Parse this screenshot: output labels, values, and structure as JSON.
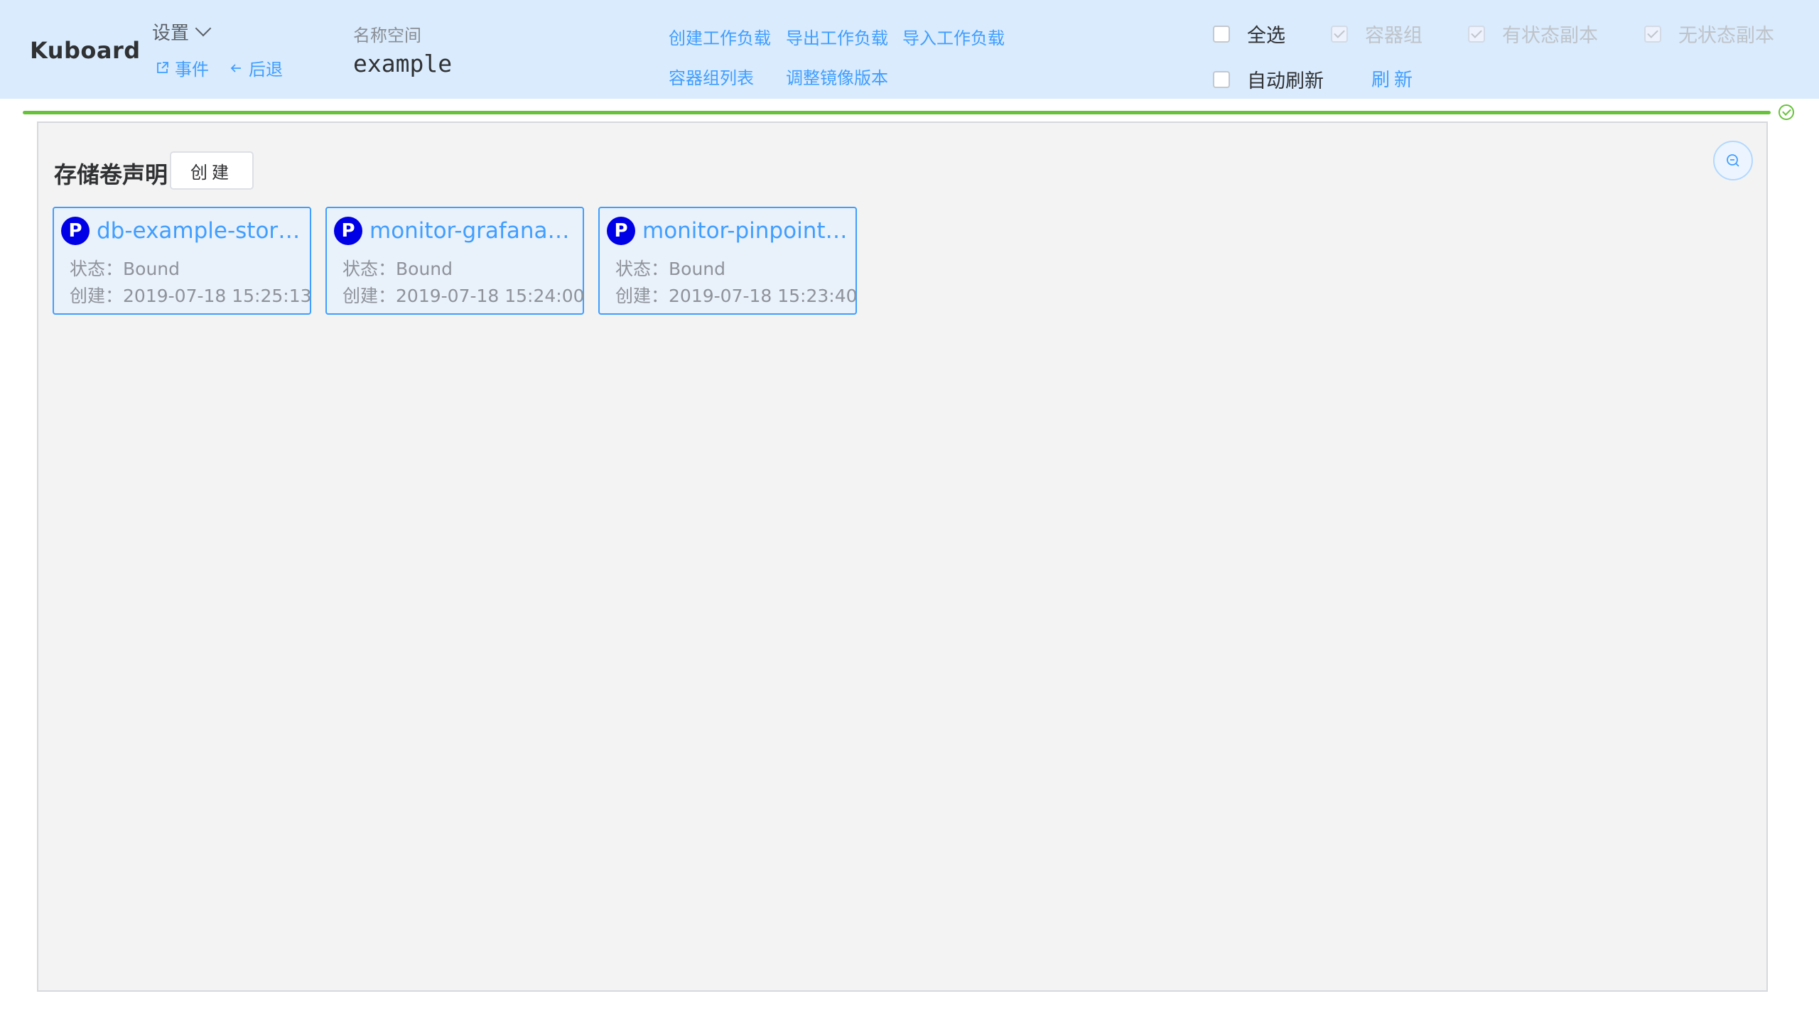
{
  "brand": "Kuboard",
  "header": {
    "settings_label": "设置",
    "events_label": "事件",
    "back_label": "后退",
    "namespace_label": "名称空间",
    "namespace_value": "example",
    "actions": {
      "create_workload": "创建工作负载",
      "export_workload": "导出工作负载",
      "import_workload": "导入工作负载",
      "pod_list": "容器组列表",
      "adjust_image": "调整镜像版本"
    },
    "filters": {
      "select_all": "全选",
      "pods": "容器组",
      "stateful": "有状态副本",
      "stateless": "无状态副本",
      "auto_refresh": "自动刷新",
      "refresh": "刷新"
    }
  },
  "section": {
    "title": "存储卷声明",
    "create_label": "创建"
  },
  "pvc_cards": [
    {
      "badge": "P",
      "name": "db-example-storage",
      "status_label": "状态：",
      "status": "Bound",
      "created_label": "创建：",
      "created": "2019-07-18 15:25:13"
    },
    {
      "badge": "P",
      "name": "monitor-grafana-storage",
      "status_label": "状态：",
      "status": "Bound",
      "created_label": "创建：",
      "created": "2019-07-18 15:24:00"
    },
    {
      "badge": "P",
      "name": "monitor-pinpoint-storage",
      "status_label": "状态：",
      "status": "Bound",
      "created_label": "创建：",
      "created": "2019-07-18 15:23:40"
    }
  ],
  "progress_percent": 100,
  "icons": [
    "chevron-down-icon",
    "external-link-icon",
    "arrow-left-icon",
    "check-circle-icon",
    "zoom-out-icon"
  ],
  "colors": {
    "header_bg": "#d9ebfd",
    "link": "#409eff",
    "progress": "#67c23a",
    "badge": "#0000e6"
  }
}
